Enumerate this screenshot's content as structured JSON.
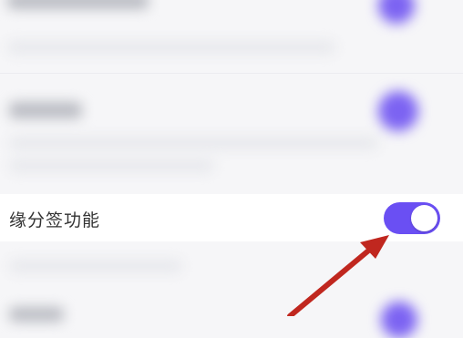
{
  "settings": {
    "feature_row": {
      "label": "缘分签功能",
      "toggle_state": "on"
    }
  },
  "colors": {
    "toggle_on": "#6a4ff3",
    "arrow": "#c0271f",
    "accent_blurred": "#7c63f2"
  },
  "icons": {
    "annotation": "red-arrow-icon"
  }
}
